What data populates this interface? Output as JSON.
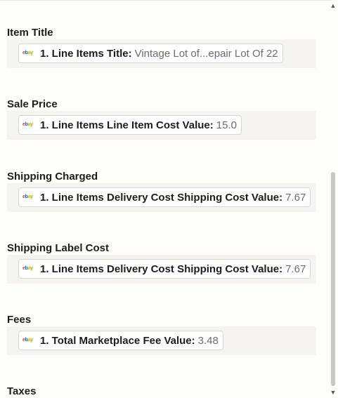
{
  "fields": [
    {
      "label": "Item Title",
      "pill_key": "1. Line Items Title:",
      "pill_value": "Vintage Lot of...epair Lot Of 22"
    },
    {
      "label": "Sale Price",
      "pill_key": "1. Line Items Line Item Cost Value:",
      "pill_value": "15.0"
    },
    {
      "label": "Shipping Charged",
      "pill_key": "1. Line Items Delivery Cost Shipping Cost Value:",
      "pill_value": "7.67"
    },
    {
      "label": "Shipping Label Cost",
      "pill_key": "1. Line Items Delivery Cost Shipping Cost Value:",
      "pill_value": "7.67"
    },
    {
      "label": "Fees",
      "pill_key": "1. Total Marketplace Fee Value:",
      "pill_value": "3.48"
    },
    {
      "label": "Taxes"
    }
  ],
  "app_icon": {
    "name": "ebay-icon",
    "text": "ebay",
    "colors": [
      "#e53238",
      "#0064d2",
      "#f5af02",
      "#86b817"
    ]
  }
}
